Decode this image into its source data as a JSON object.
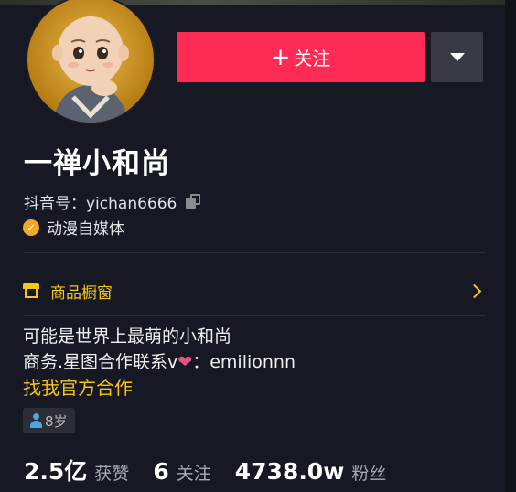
{
  "profile": {
    "name": "一禅小和尚",
    "douyin_id_label": "抖音号：yichan6666",
    "verification": "动漫自媒体"
  },
  "actions": {
    "follow_plus": "+",
    "follow_label": "关注"
  },
  "shop": {
    "label": "商品橱窗"
  },
  "bio": {
    "line1": "可能是世界上最萌的小和尚",
    "line2_prefix": "商务.星图合作联系v",
    "line2_heart": "❤",
    "line2_suffix": "：emilionnn",
    "link": "找我官方合作"
  },
  "tags": {
    "age": "8岁"
  },
  "stats": {
    "likes_num": "2.5亿",
    "likes_label": "获赞",
    "following_num": "6",
    "following_label": "关注",
    "fans_num": "4738.0w",
    "fans_label": "粉丝"
  },
  "colors": {
    "background": "#161823",
    "follow_button": "#fe2c55",
    "accent_yellow": "#f5c518",
    "verify_orange": "#f5a623"
  }
}
